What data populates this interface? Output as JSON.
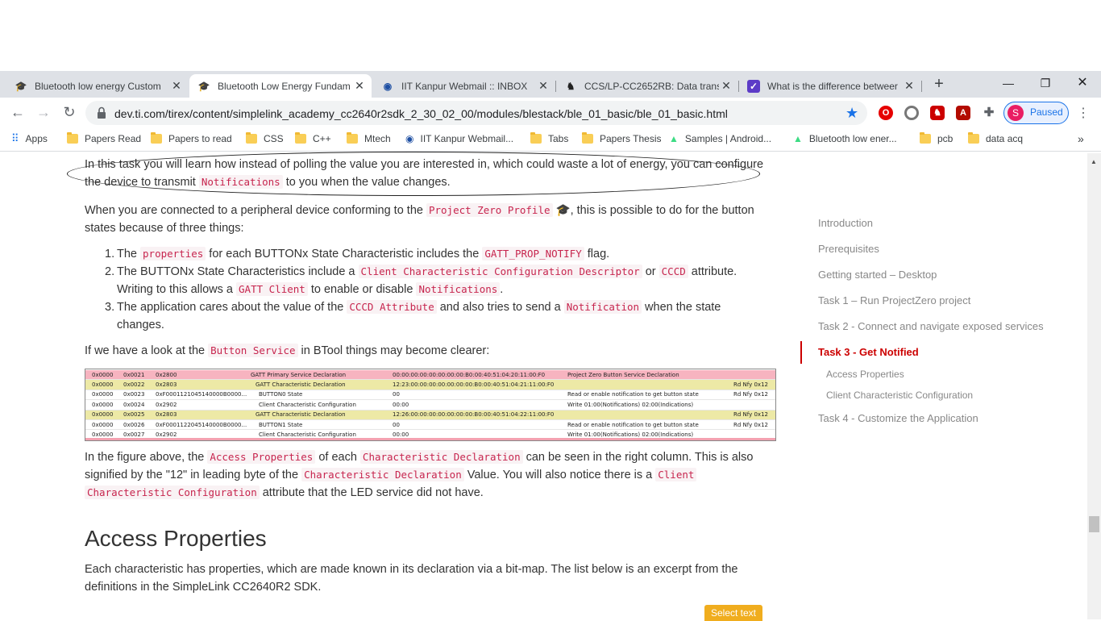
{
  "browser": {
    "tabs": [
      {
        "title": "Bluetooth low energy Custom",
        "icon": "graduation-cap-icon"
      },
      {
        "title": "Bluetooth Low Energy Fundam",
        "icon": "graduation-cap-icon",
        "active": true
      },
      {
        "title": "IIT Kanpur Webmail :: INBOX",
        "icon": "webmail-icon"
      },
      {
        "title": "CCS/LP-CC2652RB: Data transf",
        "icon": "ti-icon"
      },
      {
        "title": "What is the difference betweer",
        "icon": "quora-icon"
      }
    ],
    "url": "dev.ti.com/tirex/content/simplelink_academy_cc2640r2sdk_2_30_02_00/modules/blestack/ble_01_basic/ble_01_basic.html",
    "profile_initial": "S",
    "profile_status": "Paused",
    "bookmarks": [
      {
        "label": "Apps",
        "icon": "apps-grid-icon"
      },
      {
        "label": "Papers Read",
        "icon": "folder-icon"
      },
      {
        "label": "Papers to read",
        "icon": "folder-icon"
      },
      {
        "label": "CSS",
        "icon": "folder-icon"
      },
      {
        "label": "C++",
        "icon": "folder-icon"
      },
      {
        "label": "Mtech",
        "icon": "folder-icon"
      },
      {
        "label": "IIT Kanpur Webmail...",
        "icon": "webmail-icon"
      },
      {
        "label": "Tabs",
        "icon": "folder-icon"
      },
      {
        "label": "Papers Thesis",
        "icon": "folder-icon"
      },
      {
        "label": "Samples | Android...",
        "icon": "android-icon"
      },
      {
        "label": "Bluetooth low ener...",
        "icon": "android-icon"
      },
      {
        "label": "pcb",
        "icon": "folder-icon"
      },
      {
        "label": "data acq",
        "icon": "folder-icon"
      }
    ]
  },
  "article": {
    "p1": {
      "a": "In this task you will learn how instead of polling the value you are interested in, which could waste a lot of energy, you can configure the device to transmit ",
      "code": "Notifications",
      "b": " to you when the value changes."
    },
    "p2": {
      "a": "When you are connected to a peripheral device conforming to the ",
      "code": "Project Zero Profile",
      "b": ", this is possible to do for the button states because of three things:"
    },
    "list": [
      {
        "num": "1.",
        "a": "The ",
        "c1": "properties",
        "b": " for each BUTTONx State Characteristic includes the ",
        "c2": "GATT_PROP_NOTIFY",
        "c": " flag."
      },
      {
        "num": "2.",
        "a": "The BUTTONx State Characteristics include a ",
        "c1": "Client Characteristic Configuration Descriptor",
        "b": " or ",
        "c2": "CCCD",
        "c": " attribute.",
        "line2a": "Writing to this allows a ",
        "c3": "GATT Client",
        "line2b": " to enable or disable ",
        "c4": "Notifications",
        "line2c": "."
      },
      {
        "num": "3.",
        "a": "The application cares about the value of the ",
        "c1": "CCCD Attribute",
        "b": " and also tries to send a ",
        "c2": "Notification",
        "c": " when the state",
        "line2a": "changes."
      }
    ],
    "p3": {
      "a": "If we have a look at the ",
      "code": "Button Service",
      "b": " in BTool things may become clearer:"
    },
    "p4": {
      "a": "In the figure above, the ",
      "c1": "Access Properties",
      "b": " of each ",
      "c2": "Characteristic Declaration",
      "c": " can be seen in the right column. This is also",
      "line2a": "signified by the \"12\" in leading byte of the ",
      "c3": "Characteristic Declaration",
      "line2b": " Value. You will also notice there is a ",
      "c4": "Client",
      "c5": "Characteristic Configuration",
      "line3": " attribute that the LED service did not have."
    },
    "heading": "Access Properties",
    "p5": {
      "line1": "Each characteristic has properties, which are made known in its declaration via a bit-map. The list below is an excerpt from the",
      "line2": "definitions in the SimpleLink CC2640R2 SDK."
    },
    "select_text": "Select text"
  },
  "gatt_table": [
    {
      "c0": "0x0000",
      "c1": "0x0021",
      "c2": "0x2800",
      "c3": "GATT Primary Service Declaration",
      "c4": "00:00:00:00:00:00:00:00:B0:00:40:51:04:20:11:00:F0",
      "c5": "Project Zero Button Service Declaration",
      "c6": "",
      "bg": "pink"
    },
    {
      "c0": "0x0000",
      "c1": "0x0022",
      "c2": "0x2803",
      "c3": "GATT Characteristic Declaration",
      "c4": "12:23:00:00:00:00:00:00:00:B0:00:40:51:04:21:11:00:F0",
      "c5": "",
      "c6": "Rd Nfy  0x12",
      "bg": "yellow"
    },
    {
      "c0": "0x0000",
      "c1": "0x0023",
      "c2": "0xF0001121045140000B0000...",
      "c3": "BUTTON0 State",
      "c4": "00",
      "c5": "Read or enable notification to get button state",
      "c6": "Rd Nfy  0x12",
      "bg": "white"
    },
    {
      "c0": "0x0000",
      "c1": "0x0024",
      "c2": "0x2902",
      "c3": "Client Characteristic Configuration",
      "c4": "00:00",
      "c5": "Write 01:00(Notifications) 02:00(Indications)",
      "c6": "",
      "bg": "white"
    },
    {
      "c0": "0x0000",
      "c1": "0x0025",
      "c2": "0x2803",
      "c3": "GATT Characteristic Declaration",
      "c4": "12:26:00:00:00:00:00:00:00:B0:00:40:51:04:22:11:00:F0",
      "c5": "",
      "c6": "Rd Nfy  0x12",
      "bg": "yellow"
    },
    {
      "c0": "0x0000",
      "c1": "0x0026",
      "c2": "0xF0001122045140000B0000...",
      "c3": "BUTTON1 State",
      "c4": "00",
      "c5": "Read or enable notification to get button state",
      "c6": "Rd Nfy  0x12",
      "bg": "white"
    },
    {
      "c0": "0x0000",
      "c1": "0x0027",
      "c2": "0x2902",
      "c3": "Client Characteristic Configuration",
      "c4": "00:00",
      "c5": "Write 01:00(Notifications) 02:00(Indications)",
      "c6": "",
      "bg": "white"
    }
  ],
  "toc": {
    "items": [
      "Introduction",
      "Prerequisites",
      "Getting started – Desktop",
      "Task 1 – Run ProjectZero project",
      "Task 2 - Connect and navigate exposed services",
      "Task 3 - Get Notified",
      "Access Properties",
      "Client Characteristic Configuration",
      "Task 4 - Customize the Application"
    ],
    "active": "Task 3 - Get Notified"
  },
  "colors": {
    "accent": "#cc0000",
    "code_text": "#c7254e",
    "code_bg": "#f9f2f4",
    "chrome_blue": "#1a73e8"
  }
}
